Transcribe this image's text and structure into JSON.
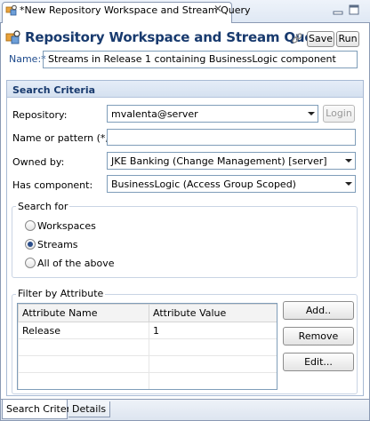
{
  "editor_tab": {
    "title": "*New Repository Workspace and Stream Query",
    "close_symbol": "✕"
  },
  "header": {
    "title": "Repository Workspace and Stream Query",
    "save_label": "Save",
    "run_label": "Run"
  },
  "name": {
    "label": "Name:*",
    "value": "Streams in Release 1 containing BusinessLogic component"
  },
  "search_criteria": {
    "title": "Search Criteria",
    "repository": {
      "label": "Repository:",
      "value": "mvalenta@server",
      "login_label": "Login"
    },
    "pattern": {
      "label": "Name or pattern (*, ?):",
      "value": ""
    },
    "owned_by": {
      "label": "Owned by:",
      "value": "JKE Banking (Change Management) [server]"
    },
    "component": {
      "label": "Has component:",
      "value": "BusinessLogic (Access Group Scoped)"
    },
    "search_for": {
      "title": "Search for",
      "options": [
        {
          "label": "Workspaces",
          "selected": false
        },
        {
          "label": "Streams",
          "selected": true
        },
        {
          "label": "All of the above",
          "selected": false
        }
      ]
    },
    "filter": {
      "title": "Filter by Attribute",
      "columns": [
        "Attribute Name",
        "Attribute Value"
      ],
      "rows": [
        [
          "Release",
          "1"
        ]
      ],
      "add_label": "Add..",
      "remove_label": "Remove",
      "edit_label": "Edit..."
    }
  },
  "bottom_tabs": [
    "Search Criteria",
    "Details"
  ],
  "colors": {
    "title_blue": "#183a6e",
    "border": "#8a99b3",
    "field_border": "#7f9db9"
  }
}
